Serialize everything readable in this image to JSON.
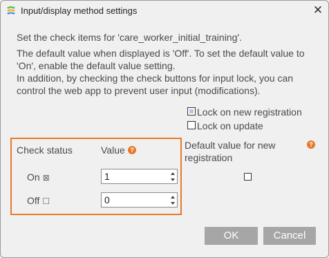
{
  "window": {
    "title": "Input/display method settings",
    "close_glyph": "✕"
  },
  "description": {
    "line1": "Set the check items for 'care_worker_initial_training'.",
    "line2": "The default value when displayed is 'Off'. To set the default value to 'On', enable the default value setting.",
    "line3": "In addition, by checking the check buttons for input lock, you can control the web app to prevent user input (modifications)."
  },
  "locks": {
    "new_registration": {
      "label": "Lock on new registration",
      "checked": true
    },
    "on_update": {
      "label": "Lock on update",
      "checked": false
    }
  },
  "table": {
    "header_check_status": "Check status",
    "header_value": "Value",
    "header_default": "Default value for new registration",
    "help_glyph": "?",
    "rows": [
      {
        "label": "On",
        "glyph": "⊠",
        "value": "1"
      },
      {
        "label": "Off",
        "glyph": "☐",
        "value": "0"
      }
    ]
  },
  "buttons": {
    "ok": "OK",
    "cancel": "Cancel"
  },
  "colors": {
    "highlight": "#e8792b",
    "button_bg": "#a6a6a6",
    "help_icon": "#e8792b"
  }
}
